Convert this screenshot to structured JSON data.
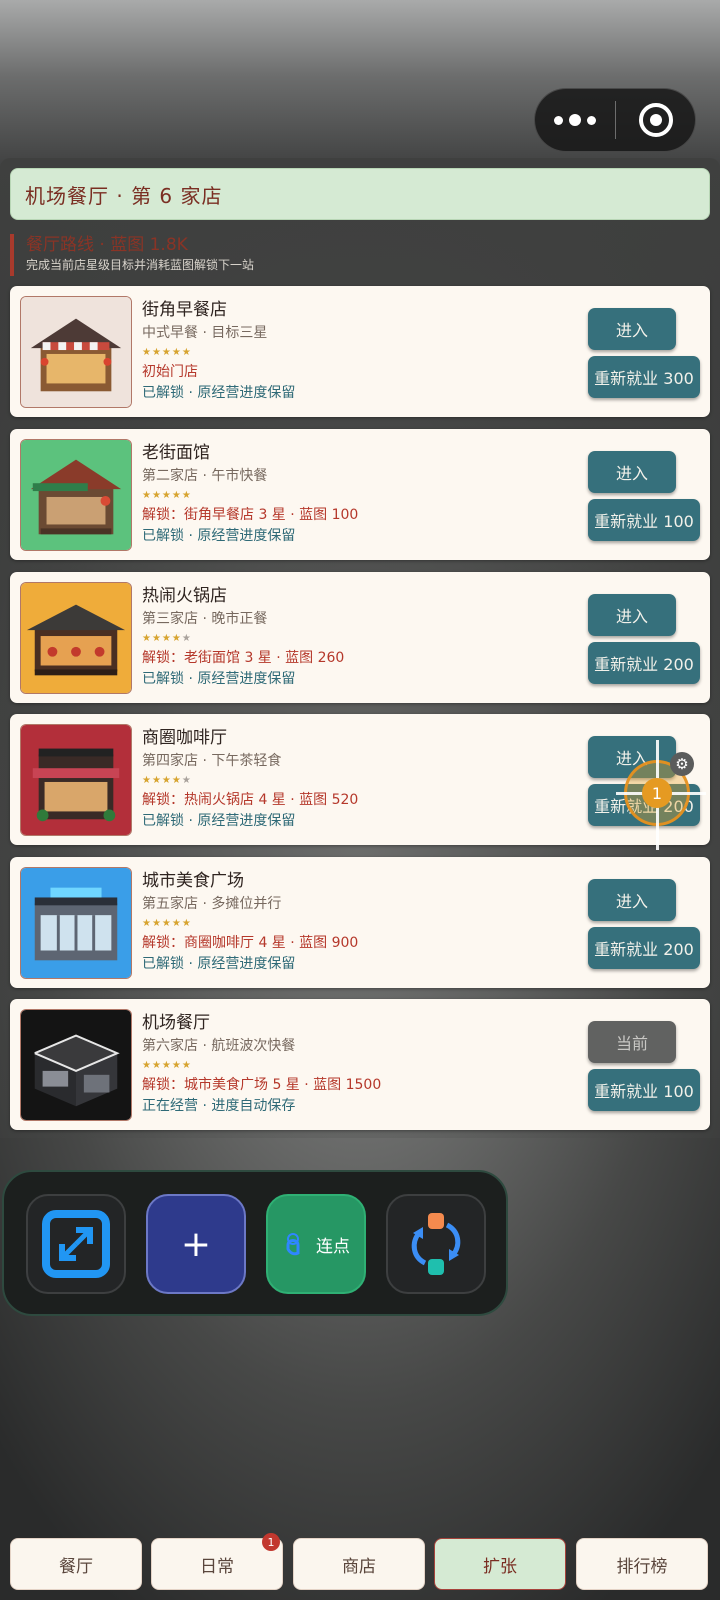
{
  "header": {
    "title": "机场餐厅 · 第 6 家店"
  },
  "route": {
    "title": "餐厅路线 · 蓝图 1.8K",
    "subtitle": "完成当前店星级目标并消耗蓝图解锁下一站"
  },
  "restaurants": [
    {
      "name": "街角早餐店",
      "subtitle": "中式早餐 · 目标三星",
      "stars": "★★★★★",
      "stars_dim": "",
      "unlock": "初始门店",
      "status": "已解锁 · 原经营进度保留",
      "enter_label": "进入",
      "rehire_label": "重新就业 300",
      "thumb_color": "#f0e4dc",
      "thumb_icon": "breakfast-shop-icon"
    },
    {
      "name": "老街面馆",
      "subtitle": "第二家店 · 午市快餐",
      "stars": "★★★★★",
      "stars_dim": "",
      "unlock": "解锁：街角早餐店 3 星 · 蓝图 100",
      "status": "已解锁 · 原经营进度保留",
      "enter_label": "进入",
      "rehire_label": "重新就业 100",
      "thumb_color": "#5cc27d",
      "thumb_icon": "noodle-shop-icon"
    },
    {
      "name": "热闹火锅店",
      "subtitle": "第三家店 · 晚市正餐",
      "stars": "★★★★",
      "stars_dim": "★",
      "unlock": "解锁：老街面馆 3 星 · 蓝图 260",
      "status": "已解锁 · 原经营进度保留",
      "enter_label": "进入",
      "rehire_label": "重新就业 200",
      "thumb_color": "#efac3a",
      "thumb_icon": "hotpot-shop-icon"
    },
    {
      "name": "商圈咖啡厅",
      "subtitle": "第四家店 · 下午茶轻食",
      "stars": "★★★★",
      "stars_dim": "★",
      "unlock": "解锁：热闹火锅店 4 星 · 蓝图 520",
      "status": "已解锁 · 原经营进度保留",
      "enter_label": "进入",
      "rehire_label": "重新就业 200",
      "thumb_color": "#b32f3a",
      "thumb_icon": "cafe-shop-icon"
    },
    {
      "name": "城市美食广场",
      "subtitle": "第五家店 · 多摊位并行",
      "stars": "★★★★★",
      "stars_dim": "",
      "unlock": "解锁：商圈咖啡厅 4 星 · 蓝图 900",
      "status": "已解锁 · 原经营进度保留",
      "enter_label": "进入",
      "rehire_label": "重新就业 200",
      "thumb_color": "#3a9ee8",
      "thumb_icon": "food-court-icon"
    },
    {
      "name": "机场餐厅",
      "subtitle": "第六家店 · 航班波次快餐",
      "stars": "★★★★★",
      "stars_dim": "",
      "unlock": "解锁：城市美食广场 5 星 · 蓝图 1500",
      "status": "正在经营 · 进度自动保存",
      "enter_label": "当前",
      "rehire_label": "重新就业 100",
      "thumb_color": "#141414",
      "thumb_icon": "airport-restaurant-icon"
    }
  ],
  "tools": {
    "add_label": "+",
    "tap_label": "连点"
  },
  "target": {
    "number": "1"
  },
  "tabs": [
    {
      "label": "餐厅"
    },
    {
      "label": "日常",
      "badge": "1"
    },
    {
      "label": "商店"
    },
    {
      "label": "扩张"
    },
    {
      "label": "排行榜"
    }
  ]
}
